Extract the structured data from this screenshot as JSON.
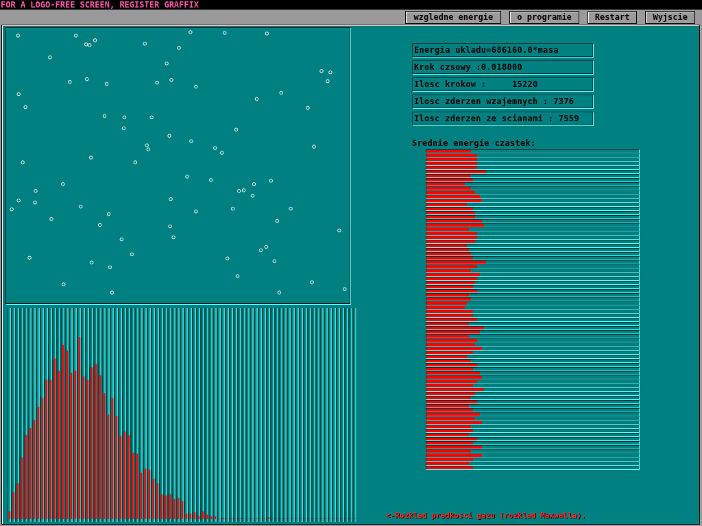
{
  "banner": "FOR A LOGO-FREE SCREEN, REGISTER GRAFFIX",
  "toolbar": {
    "buttons": [
      {
        "label": "wzgledne energie"
      },
      {
        "label": "o programie"
      },
      {
        "label": "Restart"
      },
      {
        "label": "Wyjscie"
      }
    ]
  },
  "stats": [
    {
      "text": "Energia ukladu=686160.0*masa"
    },
    {
      "text": "Krok czsowy :0.018000"
    },
    {
      "text": "Ilosc krokow :     15220"
    },
    {
      "text": "Ilosc zderzen wzajemnych : 7376"
    },
    {
      "text": "Ilosc zderzen ze scianami : 7559"
    }
  ],
  "energy_panel": {
    "title": "Srednie energie czastek:",
    "bars": [
      {
        "level": 0.21
      },
      {
        "level": 0.24
      },
      {
        "level": 0.24
      },
      {
        "level": 0.24
      },
      {
        "level": 0.24
      },
      {
        "level": 0.28
      },
      {
        "level": 0.21
      },
      {
        "level": 0.22
      },
      {
        "level": 0.18
      },
      {
        "level": 0.21
      },
      {
        "level": 0.23
      },
      {
        "level": 0.25
      },
      {
        "level": 0.26
      },
      {
        "level": 0.19
      },
      {
        "level": 0.22
      },
      {
        "level": 0.23
      },
      {
        "level": 0.23
      },
      {
        "level": 0.26
      },
      {
        "level": 0.27
      },
      {
        "level": 0.2
      },
      {
        "level": 0.24
      },
      {
        "level": 0.24
      },
      {
        "level": 0.23
      },
      {
        "level": 0.19
      },
      {
        "level": 0.2
      },
      {
        "level": 0.21
      },
      {
        "level": 0.22
      },
      {
        "level": 0.28
      },
      {
        "level": 0.24
      },
      {
        "level": 0.21
      },
      {
        "level": 0.25
      },
      {
        "level": 0.24
      },
      {
        "level": 0.23
      },
      {
        "level": 0.22
      },
      {
        "level": 0.24
      },
      {
        "level": 0.2
      },
      {
        "level": 0.21
      },
      {
        "level": 0.19
      },
      {
        "level": 0.18
      },
      {
        "level": 0.22
      },
      {
        "level": 0.22
      },
      {
        "level": 0.24
      },
      {
        "level": 0.2
      },
      {
        "level": 0.27
      },
      {
        "level": 0.25
      },
      {
        "level": 0.2
      },
      {
        "level": 0.24
      },
      {
        "level": 0.23
      },
      {
        "level": 0.26
      },
      {
        "level": 0.22
      },
      {
        "level": 0.19
      },
      {
        "level": 0.21
      },
      {
        "level": 0.24
      },
      {
        "level": 0.22
      },
      {
        "level": 0.25
      },
      {
        "level": 0.26
      },
      {
        "level": 0.24
      },
      {
        "level": 0.22
      },
      {
        "level": 0.27
      },
      {
        "level": 0.23
      },
      {
        "level": 0.21
      },
      {
        "level": 0.24
      },
      {
        "level": 0.2
      },
      {
        "level": 0.22
      },
      {
        "level": 0.25
      },
      {
        "level": 0.23
      },
      {
        "level": 0.26
      },
      {
        "level": 0.21
      },
      {
        "level": 0.22
      },
      {
        "level": 0.2
      },
      {
        "level": 0.24
      },
      {
        "level": 0.22
      },
      {
        "level": 0.26
      },
      {
        "level": 0.21
      },
      {
        "level": 0.26
      },
      {
        "level": 0.22
      },
      {
        "level": 0.2
      },
      {
        "level": 0.22
      }
    ]
  },
  "caption": "<-Rozklad predkosci gazu (rozklad Maxwella)."
}
